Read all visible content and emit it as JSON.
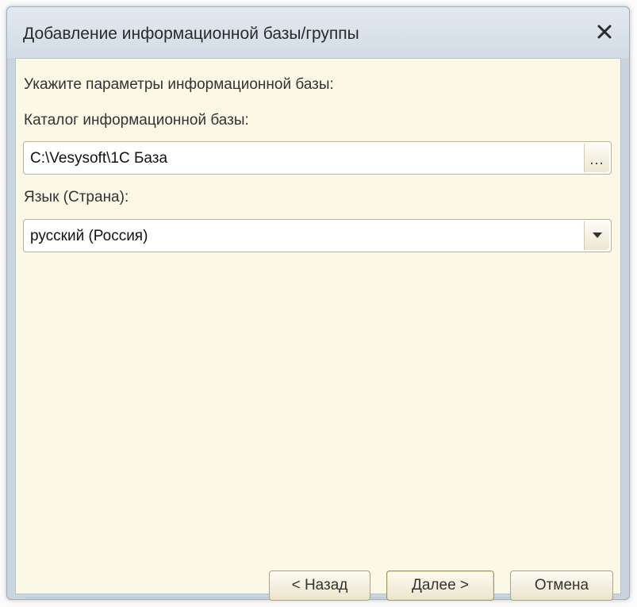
{
  "dialog": {
    "title": "Добавление информационной базы/группы"
  },
  "form": {
    "heading": "Укажите параметры информационной базы:",
    "catalog_label": "Каталог информационной базы:",
    "catalog_value": "C:\\Vesysoft\\1C База",
    "browse_label": "...",
    "language_label": "Язык (Страна):",
    "language_value": "русский (Россия)"
  },
  "buttons": {
    "back": "< Назад",
    "next": "Далее >",
    "cancel": "Отмена"
  },
  "icons": {
    "close": "close-icon",
    "dropdown": "chevron-down-icon"
  },
  "colors": {
    "client_background": "#fbf8e6",
    "title_bar": "#d8e0e9"
  }
}
